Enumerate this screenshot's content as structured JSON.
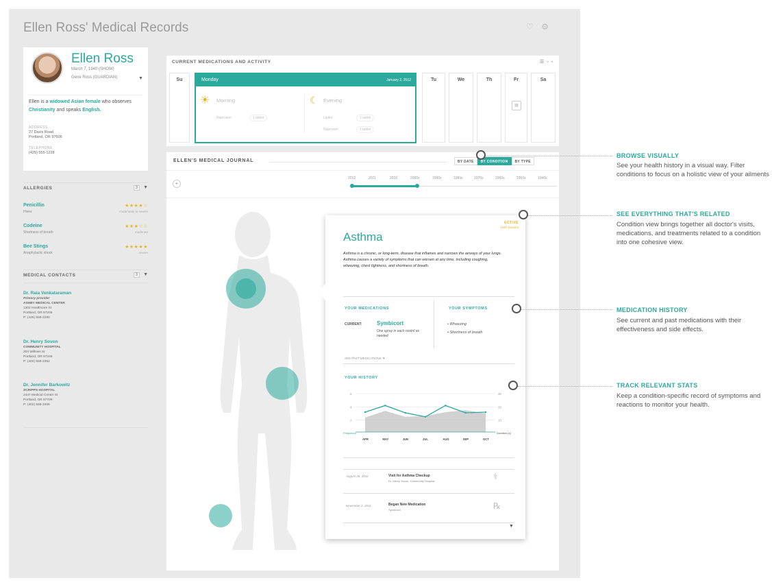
{
  "app": {
    "title": "Ellen Ross' Medical Records",
    "top_icons": "♡ ⚙"
  },
  "profile": {
    "name": "Ellen Ross",
    "dob": "March 7, 1940 (SHOW)",
    "guardian": "Gene Ross (GUARDIAN)",
    "bio_pre": "Ellen is a ",
    "bio_hl1": "widowed Asian female",
    "bio_mid": " who observes ",
    "bio_hl2": "Christianity",
    "bio_mid2": " and speaks ",
    "bio_hl3": "English.",
    "address_label": "ADDRESS",
    "address_1": "27 Davis Road",
    "address_2": "Portland, OR 97606",
    "phone_label": "TELEPHONE",
    "phone": "(425) 555-1228"
  },
  "allergies": {
    "title": "ALLERGIES",
    "count": "3",
    "items": [
      {
        "name": "Penicillin",
        "reaction": "Hives",
        "stars": "★★★★☆",
        "note": "moderately to severe"
      },
      {
        "name": "Codeine",
        "reaction": "Shortness of breath",
        "stars": "★★★☆☆",
        "note": "moderate"
      },
      {
        "name": "Bee Stings",
        "reaction": "Anaphylactic shock",
        "stars": "★★★★★",
        "note": "severe"
      }
    ]
  },
  "contacts": {
    "title": "MEDICAL CONTACTS",
    "count": "3",
    "items": [
      {
        "name": "Dr. Raia Venkataraman",
        "role": "Primary provider",
        "org": "ASHBY MEDICAL CENTER",
        "addr1": "1302 Healthcare St",
        "addr2": "Portland, OR 97206",
        "phone": "P: (425) 555-2290"
      },
      {
        "name": "Dr. Henry Sovon",
        "role": "",
        "org": "COMMUNITY HOSPITAL",
        "addr1": "304 Willows St",
        "addr2": "Portland, OR 97349",
        "phone": "P: (402) 555-2352"
      },
      {
        "name": "Dr. Jennifer Barkowitz",
        "role": "",
        "org": "SCRIPPS HOSPITAL",
        "addr1": "2447 Medical Center St",
        "addr2": "Portland, OR 97709",
        "phone": "P: (402) 555-3455"
      }
    ]
  },
  "meds": {
    "title": "CURRENT MEDICATIONS AND ACTIVITY",
    "view_icons": "☰ ▫ ▫",
    "days": [
      "Su",
      "Tu",
      "We",
      "Th",
      "Fr",
      "Sa"
    ],
    "today": "Monday",
    "today_date": "January 2, 2012",
    "morning": {
      "label": "Morning",
      "med": "Naproxen",
      "dose": "1 tablet"
    },
    "evening": {
      "label": "Evening",
      "items": [
        {
          "med": "Lipitor",
          "dose": "1 tablet"
        },
        {
          "med": "Naproxen",
          "dose": "1 tablet"
        }
      ]
    }
  },
  "journal": {
    "title": "ELLEN'S MEDICAL JOURNAL",
    "filters": [
      "BY DATE",
      "BY CONDITION",
      "BY TYPE"
    ],
    "active_filter": "BY CONDITION",
    "add_label": "+",
    "timeline": [
      "2012",
      "2011",
      "2010",
      "2000s",
      "1990s",
      "1980s",
      "1970s",
      "1960s",
      "1950s",
      "1940s"
    ]
  },
  "condition": {
    "status": "ACTIVE",
    "status_sub": "1987-present",
    "title": "Asthma",
    "description": "Asthma is a chronic, or long-term, disease that inflames and narrows the airways of your lungs. Asthma causes a variety of symptoms that can worsen at any time, including coughing, wheezing, chest tightness, and shortness of breath.",
    "medications_title": "YOUR MEDICATIONS",
    "current_label": "CURRENT:",
    "medication": "Symbicort",
    "instructions": "One spray in each nostril as needed",
    "symptoms_title": "YOUR SYMPTOMS",
    "symptoms": [
      "• Wheezing",
      "• Shortness of breath"
    ],
    "past_meds": "SEE PAST MEDICATIONS ▼",
    "history_title": "YOUR HISTORY",
    "legend_left": "Frequency",
    "legend_right": "Duration (s)",
    "events": [
      {
        "date": "August 28, 2012",
        "title": "Visit for Asthma Checkup",
        "sub": "Dr. Henry Sovon, Community Hospital",
        "icon": "doctor-icon"
      },
      {
        "date": "November 2, 2011",
        "title": "Began New Medication",
        "sub": "Symbicort",
        "icon": "medication-icon"
      }
    ]
  },
  "chart_data": {
    "type": "line",
    "categories": [
      "APR",
      "MAY",
      "JUN",
      "JUL",
      "AUG",
      "SEP",
      "OCT"
    ],
    "ylim": [
      0,
      6
    ],
    "y_ticks": [
      "6",
      "4",
      "2"
    ],
    "y2_ticks": [
      "30",
      "20",
      "10"
    ],
    "series": [
      {
        "name": "Frequency",
        "kind": "area",
        "values": [
          2.2,
          3.2,
          2.3,
          2.4,
          3.0,
          3.3,
          2.8
        ]
      },
      {
        "name": "Duration (s)",
        "kind": "line",
        "values": [
          3.0,
          4.0,
          2.9,
          2.3,
          4.0,
          2.9,
          3.0
        ]
      }
    ],
    "colors": {
      "area": "#c9c9c9",
      "line": "#2ba99c"
    }
  },
  "callouts": [
    {
      "title": "BROWSE VISUALLY",
      "text": "See your health history in a visual way. Filter conditions to focus on a holistic view of your ailments"
    },
    {
      "title": "SEE EVERYTHING THAT'S RELATED",
      "text": "Condition view brings together all doctor's visits, medications, and treatments related to a condition into one cohesive view."
    },
    {
      "title": "MEDICATION HISTORY",
      "text": "See current and past medications with their effectiveness and side effects."
    },
    {
      "title": "TRACK RELEVANT STATS",
      "text": "Keep a condition-specific record of symptoms and reactions to monitor your health."
    }
  ]
}
